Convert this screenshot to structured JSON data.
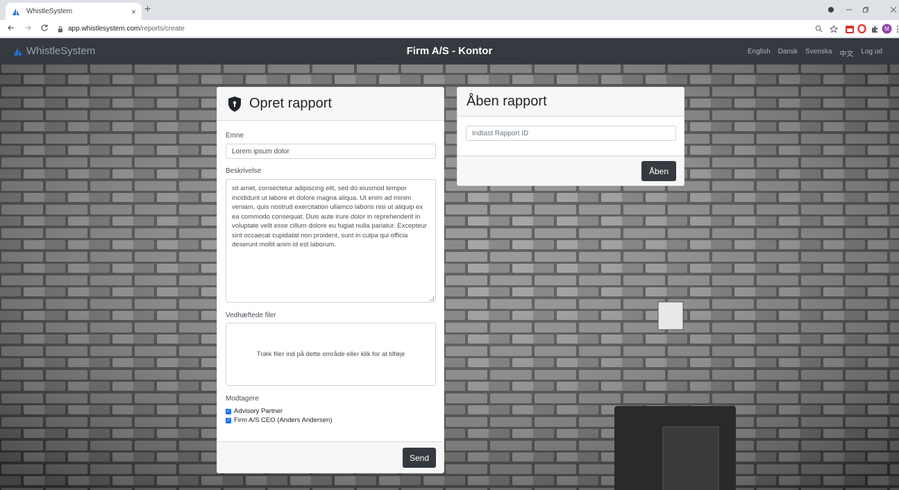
{
  "browser": {
    "tab_title": "WhistleSystem",
    "url_host": "app.whistlesystem.com",
    "url_path": "/reports/create",
    "new_tab_symbol": "+",
    "close_symbol": "×",
    "extension_badge": "M"
  },
  "nav": {
    "brand": "WhistleSystem",
    "title": "Firm A/S - Kontor",
    "languages": [
      "English",
      "Dansk",
      "Svenska",
      "中文"
    ],
    "logout": "Log ud"
  },
  "create": {
    "title": "Opret rapport",
    "subject_label": "Emne",
    "subject_value": "Lorem ipsum dolor",
    "description_label": "Beskrivelse",
    "description_value": "sit amet, consectetur adipiscing elit, sed do eiusmod tempor incididunt ut labore et dolore magna aliqua. Ut enim ad minim veniam, quis nostrud exercitation ullamco laboris nisi ut aliquip ex ea commodo consequat. Duis aute irure dolor in reprehenderit in voluptate velit esse cillum dolore eu fugiat nulla pariatur. Excepteur sint occaecat cupidatat non proident, sunt in culpa qui officia deserunt mollit anim id est laborum.",
    "attachments_label": "Vedhæftede filer",
    "dropzone_text": "Træk filer ind på dette område eller klik for at tilføje",
    "recipients_label": "Modtagere",
    "recipients": [
      {
        "name": "Advisory Partner",
        "checked": true
      },
      {
        "name": "Firm A/S CEO (Anders Andersen)",
        "checked": true
      }
    ],
    "send_label": "Send"
  },
  "open": {
    "title": "Åben rapport",
    "input_placeholder": "Indtast Rapport ID",
    "open_label": "Åben"
  },
  "colors": {
    "navbar": "#343a40",
    "button": "#343a40",
    "checkbox": "#1a73e8"
  }
}
